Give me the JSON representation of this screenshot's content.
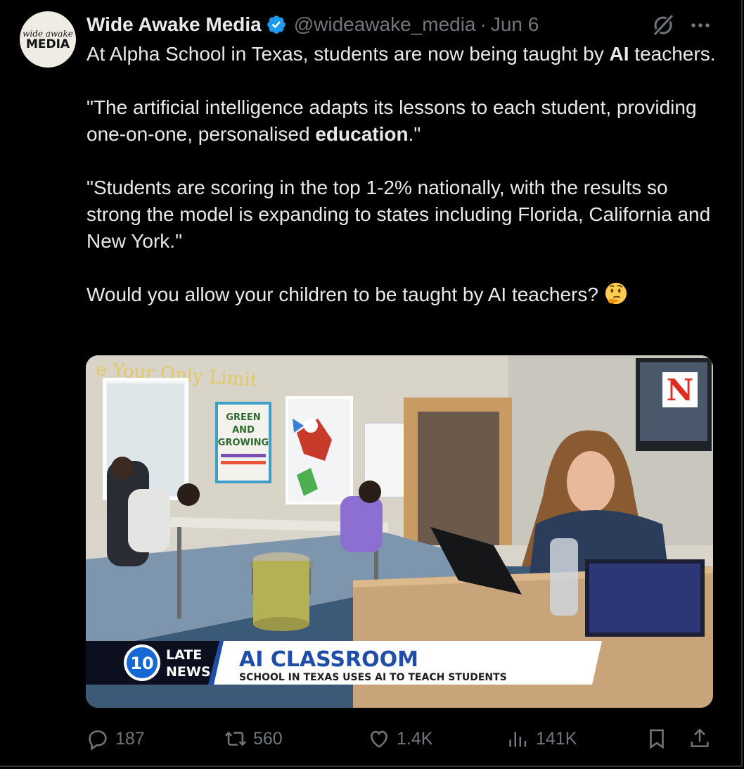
{
  "author": {
    "avatar_text_top": "wide awake",
    "avatar_text_bottom": "MEDIA",
    "display_name": "Wide Awake Media",
    "handle": "@wideawake_media",
    "separator": "·",
    "date": "Jun 6"
  },
  "tweet": {
    "p1_before": "At Alpha School in Texas, students are now being taught by ",
    "p1_bold": "AI",
    "p1_after": " teachers.",
    "p2_before": "\"The artificial intelligence adapts its lessons to each student, providing one-on-one, personalised ",
    "p2_bold": "education",
    "p2_after": ".\"",
    "p3": "\"Students are scoring in the top 1-2% nationally, with the results so strong the model is expanding to states including Florida, California and New York.\"",
    "p4": "Would you allow your children to be taught by AI teachers? "
  },
  "media": {
    "wall_text": "e Your Only Limit",
    "poster_lines": [
      "GREEN",
      "AND",
      "GROWING"
    ],
    "channel_logo": "N",
    "banner_logo_number": "10",
    "banner_logo_line1": "LATE",
    "banner_logo_line2": "NEWS",
    "banner_title": "AI CLASSROOM",
    "banner_subtitle": "SCHOOL IN TEXAS USES AI TO TEACH STUDENTS"
  },
  "actions": {
    "replies": "187",
    "reposts": "560",
    "likes": "1.4K",
    "views": "141K"
  },
  "colors": {
    "background": "#000000",
    "text": "#e7e9ea",
    "muted": "#71767b",
    "verified": "#1d9bf0"
  },
  "icons": [
    "verified-badge-icon",
    "grok-icon",
    "more-icon",
    "reply-icon",
    "repost-icon",
    "like-icon",
    "views-icon",
    "bookmark-icon",
    "share-icon",
    "thinking-face-emoji"
  ]
}
